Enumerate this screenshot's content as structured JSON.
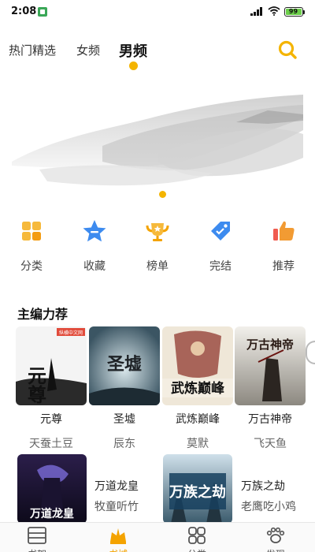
{
  "status": {
    "time": "2:08",
    "battery": "99"
  },
  "tabs": [
    {
      "label": "热门精选"
    },
    {
      "label": "女频"
    },
    {
      "label": "男频"
    }
  ],
  "categories": [
    {
      "label": "分类",
      "icon": "grid-icon"
    },
    {
      "label": "收藏",
      "icon": "star-icon"
    },
    {
      "label": "榜单",
      "icon": "trophy-icon"
    },
    {
      "label": "完结",
      "icon": "tag-icon"
    },
    {
      "label": "推荐",
      "icon": "thumbs-up-icon"
    }
  ],
  "section": {
    "title": "主编力荐"
  },
  "books": [
    {
      "title": "元尊",
      "author": "天蚕土豆",
      "cover_text": "元尊",
      "badge": "纵横中文网"
    },
    {
      "title": "圣墟",
      "author": "辰东",
      "cover_text": "圣墟"
    },
    {
      "title": "武炼巅峰",
      "author": "莫默",
      "cover_text": "武炼巅峰"
    },
    {
      "title": "万古神帝",
      "author": "飞天鱼",
      "cover_text": "万古神帝"
    }
  ],
  "books2": [
    {
      "title": "万道龙皇",
      "author": "牧童听竹",
      "cover_text": "万道龙皇"
    },
    {
      "title": "万族之劫",
      "author": "老鹰吃小鸡",
      "cover_text": "万族之劫"
    }
  ],
  "bottom_nav": [
    {
      "label": "书架",
      "icon": "bookshelf-icon"
    },
    {
      "label": "书城",
      "icon": "bookstore-icon"
    },
    {
      "label": "分类",
      "icon": "category-icon"
    },
    {
      "label": "发现",
      "icon": "paw-icon"
    }
  ],
  "colors": {
    "accent": "#f4b400",
    "icon_blue": "#3d8bef",
    "icon_orange": "#f29b33"
  }
}
